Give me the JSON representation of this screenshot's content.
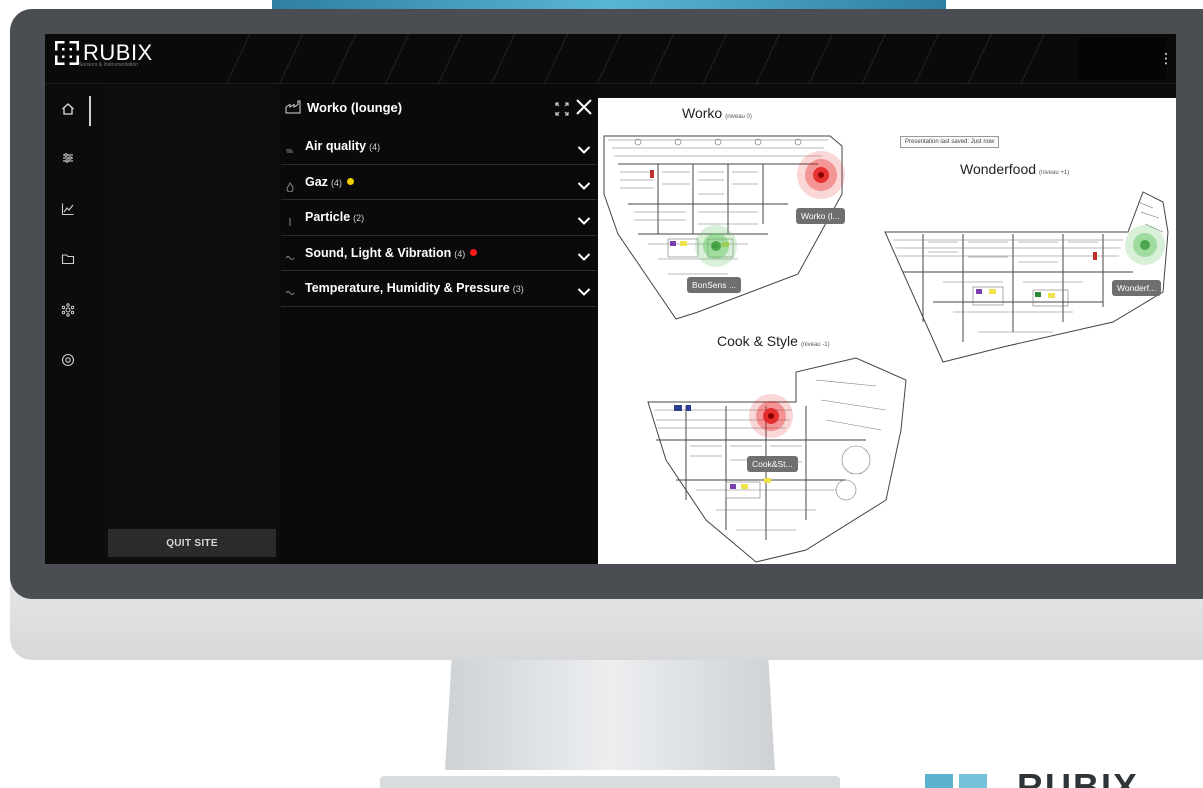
{
  "brand": {
    "name": "RUBIX",
    "tagline": "Sensors & Instrumentation",
    "accent": "#5bb3cf"
  },
  "header": {
    "menu_icon": "kebab-vertical-icon"
  },
  "rail": {
    "items": [
      {
        "icon": "home-icon",
        "active": true
      },
      {
        "icon": "sliders-icon",
        "active": false
      },
      {
        "icon": "line-chart-icon",
        "active": false
      },
      {
        "icon": "folder-icon",
        "active": false
      },
      {
        "icon": "network-icon",
        "active": false
      },
      {
        "icon": "settings-icon",
        "active": false
      }
    ]
  },
  "site_panel": {
    "quit_label": "QUIT SITE"
  },
  "sensor_panel": {
    "title": "Worko (lounge)",
    "categories": [
      {
        "label": "Air quality",
        "count": "(4)",
        "icon": "wind-icon",
        "status": null
      },
      {
        "label": "Gaz",
        "count": "(4)",
        "icon": "flame-icon",
        "status": "#f0d000"
      },
      {
        "label": "Particle",
        "count": "(2)",
        "icon": "particle-icon",
        "status": null
      },
      {
        "label": "Sound, Light & Vibration",
        "count": "(4)",
        "icon": "wave-icon",
        "status": "#ff1a1a"
      },
      {
        "label": "Temperature, Humidity & Pressure",
        "count": "(3)",
        "icon": "thermo-icon",
        "status": null
      }
    ]
  },
  "map": {
    "saved_note": "Presentation last saved: Just now",
    "plans": [
      {
        "title": "Worko",
        "level": "(niveau 0)"
      },
      {
        "title": "Wonderfood",
        "level": "(niveau +1)"
      },
      {
        "title": "Cook & Style",
        "level": "(niveau -1)"
      }
    ],
    "markers": [
      {
        "label": "Worko (l...",
        "status": "alert",
        "color": "#e41e1e"
      },
      {
        "label": "BonSens ...",
        "status": "ok",
        "color": "#5ec45e"
      },
      {
        "label": "Wonderf...",
        "status": "ok",
        "color": "#5ec45e"
      },
      {
        "label": "Cook&St...",
        "status": "alert",
        "color": "#e41e1e"
      }
    ]
  },
  "bottom_logo": "RUBIX"
}
